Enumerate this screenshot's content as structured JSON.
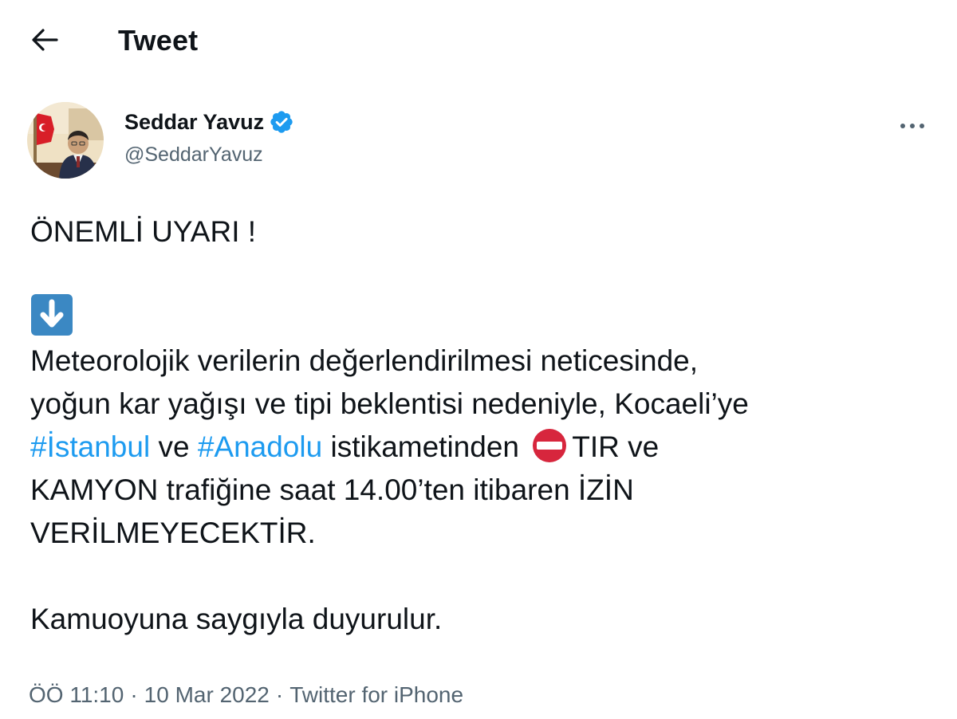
{
  "header": {
    "back_icon": "arrow-left-icon",
    "title": "Tweet"
  },
  "author": {
    "display_name": "Seddar Yavuz",
    "handle": "@SeddarYavuz",
    "verified_icon": "verified-badge-icon",
    "more_icon": "more-horizontal-icon"
  },
  "tweet": {
    "headline": "ÖNEMLİ UYARI !",
    "arrow_emoji": "down-arrow-emoji-icon",
    "line1": "Meteorolojik verilerin değerlendirilmesi neticesinde,",
    "line2": "yoğun kar yağışı ve tipi beklentisi nedeniyle, Kocaeli’ye",
    "hashtag1": "#İstanbul",
    "word_ve": "ve",
    "hashtag2": "#Anadolu",
    "word_istikametinden": "istikametinden",
    "no_entry_emoji": "no-entry-emoji-icon",
    "word_tir": "TIR ve",
    "line4": "KAMYON trafiğine saat 14.00’ten itibaren İZİN",
    "line5": "VERİLMEYECEKTİR.",
    "closing": "Kamuoyuna saygıyla duyurulur."
  },
  "meta": {
    "time": "ÖÖ 11:10",
    "separator": "·",
    "date": "10 Mar 2022",
    "source": "Twitter for iPhone"
  },
  "colors": {
    "text": "#0f1419",
    "secondary": "#536471",
    "link": "#1d9bf0",
    "verified": "#1d9bf0",
    "no_entry": "#d7263d"
  }
}
